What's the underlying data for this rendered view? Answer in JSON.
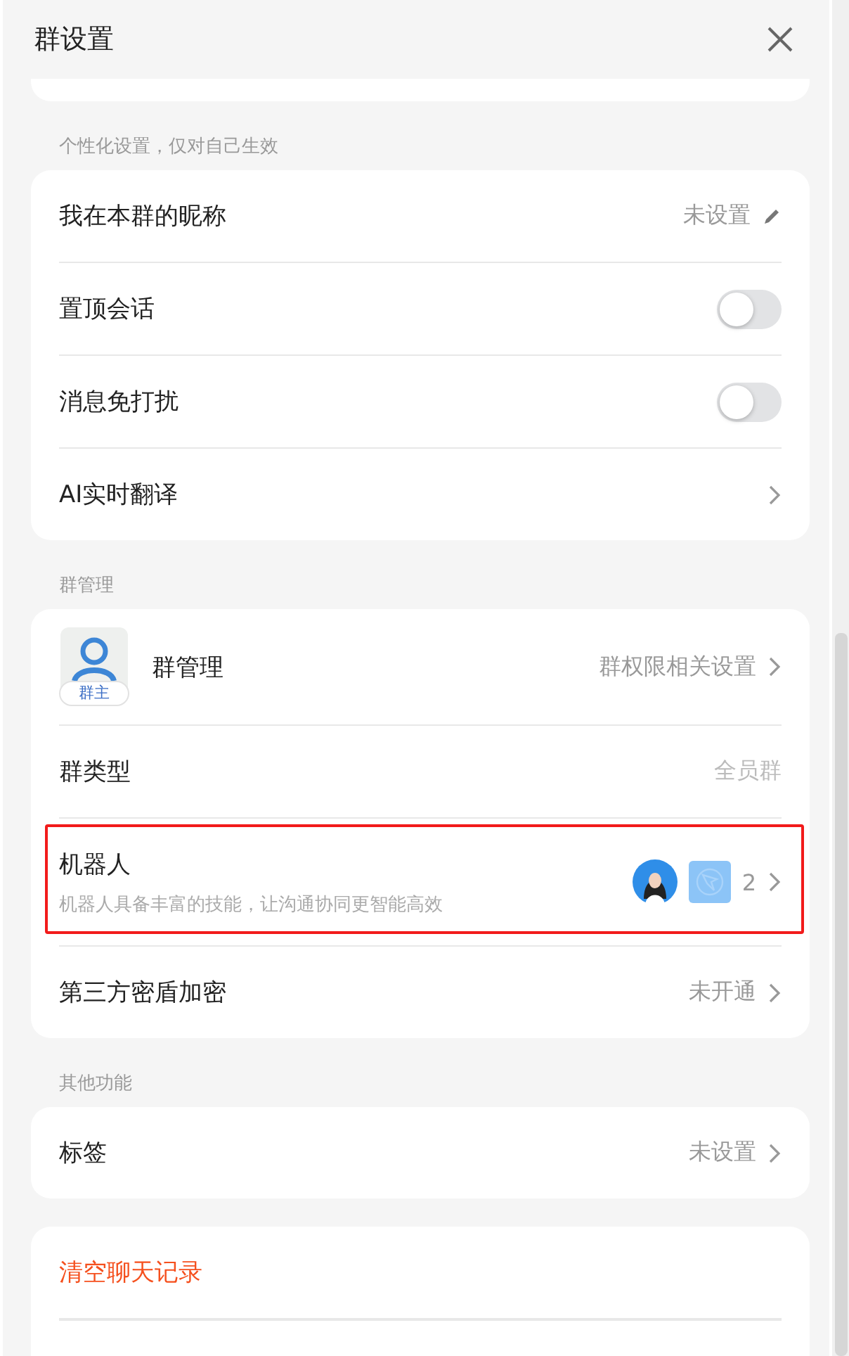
{
  "window": {
    "title": "群设置"
  },
  "sections": [
    {
      "kind": "partial"
    },
    {
      "label": "个性化设置，仅对自己生效",
      "rows": [
        {
          "kind": "edit",
          "label": "我在本群的昵称",
          "value": "未设置"
        },
        {
          "kind": "toggle",
          "label": "置顶会话",
          "on": false
        },
        {
          "kind": "toggle",
          "label": "消息免打扰",
          "on": false
        },
        {
          "kind": "link",
          "label": "AI实时翻译"
        }
      ]
    },
    {
      "label": "群管理",
      "rows": [
        {
          "kind": "owner",
          "label": "群管理",
          "badge": "群主",
          "value": "群权限相关设置"
        },
        {
          "kind": "plain",
          "label": "群类型",
          "value": "全员群"
        },
        {
          "kind": "robots",
          "label": "机器人",
          "description": "机器人具备丰富的技能，让沟通协同更智能高效",
          "count": "2",
          "highlighted": true
        },
        {
          "kind": "link",
          "label": "第三方密盾加密",
          "value": "未开通"
        }
      ]
    },
    {
      "label": "其他功能",
      "rows": [
        {
          "kind": "link",
          "label": "标签",
          "value": "未设置"
        }
      ]
    },
    {
      "rows": [
        {
          "kind": "danger",
          "label": "清空聊天记录"
        }
      ]
    }
  ]
}
